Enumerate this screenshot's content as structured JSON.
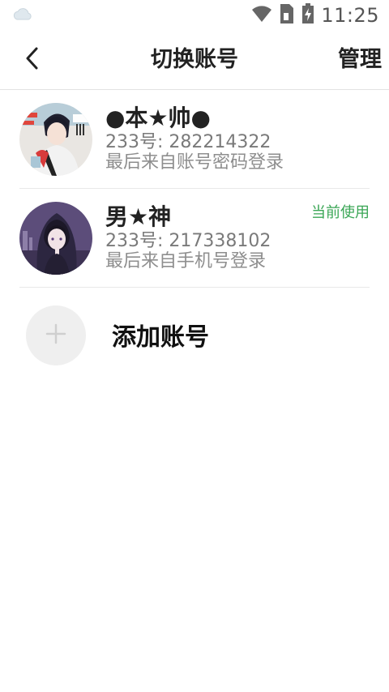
{
  "status_bar": {
    "time": "11:25",
    "left_icon": "weather-cloud-icon",
    "icons": [
      "wifi-icon",
      "sim-card-icon",
      "battery-charging-icon"
    ]
  },
  "app_bar": {
    "title": "切换账号",
    "manage_label": "管理",
    "back_icon": "back-arrow-icon"
  },
  "accounts": [
    {
      "name": "●本★帅●",
      "id_text": "233号: 282214322",
      "login_text": "最后来自账号密码登录",
      "badge": ""
    },
    {
      "name": "男★神",
      "id_text": "233号: 217338102",
      "login_text": "最后来自手机号登录",
      "badge": "当前使用"
    }
  ],
  "add_account": {
    "label": "添加账号",
    "icon": "plus-icon"
  },
  "colors": {
    "badge_green": "#3aa655",
    "divider": "#e8e8e8",
    "add_circle_bg": "#efefef"
  }
}
